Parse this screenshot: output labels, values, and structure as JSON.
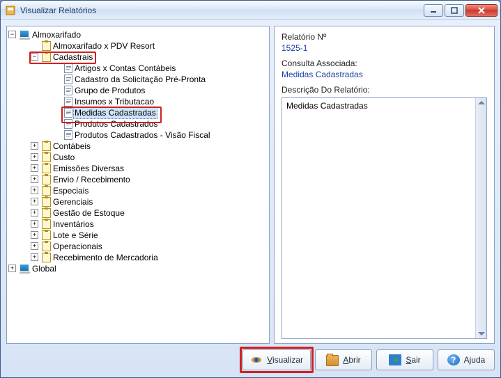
{
  "window": {
    "title": "Visualizar Relatórios"
  },
  "tree": {
    "root": {
      "label": "Almoxarifado",
      "items": [
        {
          "label": "Almoxarifado x PDV Resort",
          "icon": "clipboard",
          "leaf": true
        },
        {
          "label": "Cadastrais",
          "icon": "clipboard",
          "expanded": true,
          "children": [
            {
              "label": "Artigos x Contas Contábeis"
            },
            {
              "label": "Cadastro da Solicitação Pré-Pronta"
            },
            {
              "label": "Grupo de Produtos"
            },
            {
              "label": "Insumos x Tributacao"
            },
            {
              "label": "Medidas Cadastradas",
              "selected": true
            },
            {
              "label": "Produtos Cadastrados"
            },
            {
              "label": "Produtos Cadastrados - Visão Fiscal"
            }
          ]
        },
        {
          "label": "Contábeis",
          "icon": "clipboard"
        },
        {
          "label": "Custo",
          "icon": "clipboard"
        },
        {
          "label": "Emissões Diversas",
          "icon": "clipboard"
        },
        {
          "label": "Envio / Recebimento",
          "icon": "clipboard"
        },
        {
          "label": "Especiais",
          "icon": "clipboard"
        },
        {
          "label": "Gerenciais",
          "icon": "clipboard"
        },
        {
          "label": "Gestão de Estoque",
          "icon": "clipboard"
        },
        {
          "label": "Inventários",
          "icon": "clipboard"
        },
        {
          "label": "Lote e Série",
          "icon": "clipboard"
        },
        {
          "label": "Operacionais",
          "icon": "clipboard"
        },
        {
          "label": "Recebimento de Mercadoria",
          "icon": "clipboard"
        }
      ]
    },
    "global": {
      "label": "Global"
    }
  },
  "detail": {
    "relatorio_label": "Relatório Nº",
    "relatorio_value": "1525-1",
    "consulta_label": "Consulta Associada:",
    "consulta_value": "Medidas Cadastradas",
    "descricao_label": "Descrição Do Relatório:",
    "descricao_value": "Medidas Cadastradas"
  },
  "buttons": {
    "visualizar": "Visualizar",
    "abrir": "Abrir",
    "sair": "Sair",
    "ajuda": "Ajuda"
  }
}
